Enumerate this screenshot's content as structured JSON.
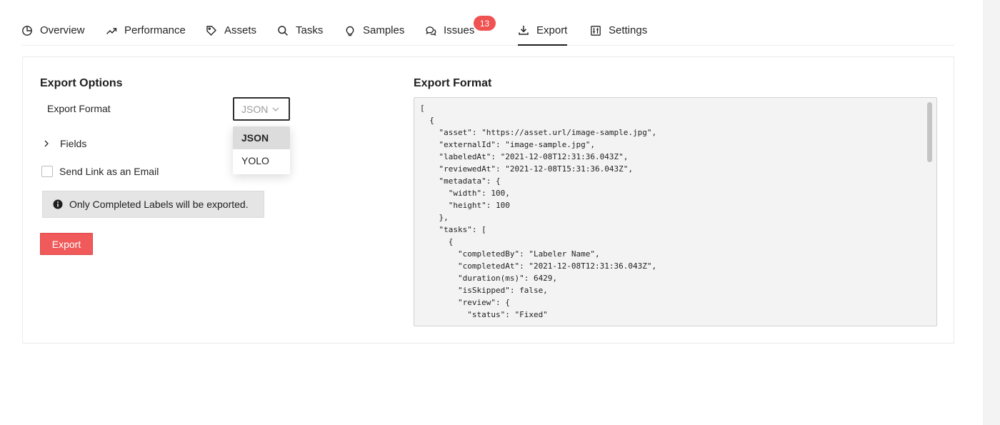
{
  "tabs": [
    {
      "label": "Overview"
    },
    {
      "label": "Performance"
    },
    {
      "label": "Assets"
    },
    {
      "label": "Tasks"
    },
    {
      "label": "Samples"
    },
    {
      "label": "Issues",
      "badge": "13"
    },
    {
      "label": "Export",
      "active": true
    },
    {
      "label": "Settings"
    }
  ],
  "options": {
    "title": "Export Options",
    "format_label": "Export Format",
    "format_value": "JSON",
    "dropdown": [
      "JSON",
      "YOLO"
    ],
    "fields_label": "Fields",
    "email_label": "Send Link as an Email",
    "notice": "Only Completed Labels will be exported.",
    "export_button": "Export"
  },
  "preview": {
    "title": "Export Format",
    "code": "[\n  {\n    \"asset\": \"https://asset.url/image-sample.jpg\",\n    \"externalId\": \"image-sample.jpg\",\n    \"labeledAt\": \"2021-12-08T12:31:36.043Z\",\n    \"reviewedAt\": \"2021-12-08T15:31:36.043Z\",\n    \"metadata\": {\n      \"width\": 100,\n      \"height\": 100\n    },\n    \"tasks\": [\n      {\n        \"completedBy\": \"Labeler Name\",\n        \"completedAt\": \"2021-12-08T12:31:36.043Z\",\n        \"duration(ms)\": 6429,\n        \"isSkipped\": false,\n        \"review\": {\n          \"status\": \"Fixed\""
  },
  "colors": {
    "accent": "#f15a5a",
    "badge": "#f05252",
    "code_bg": "#f3f3f3"
  }
}
